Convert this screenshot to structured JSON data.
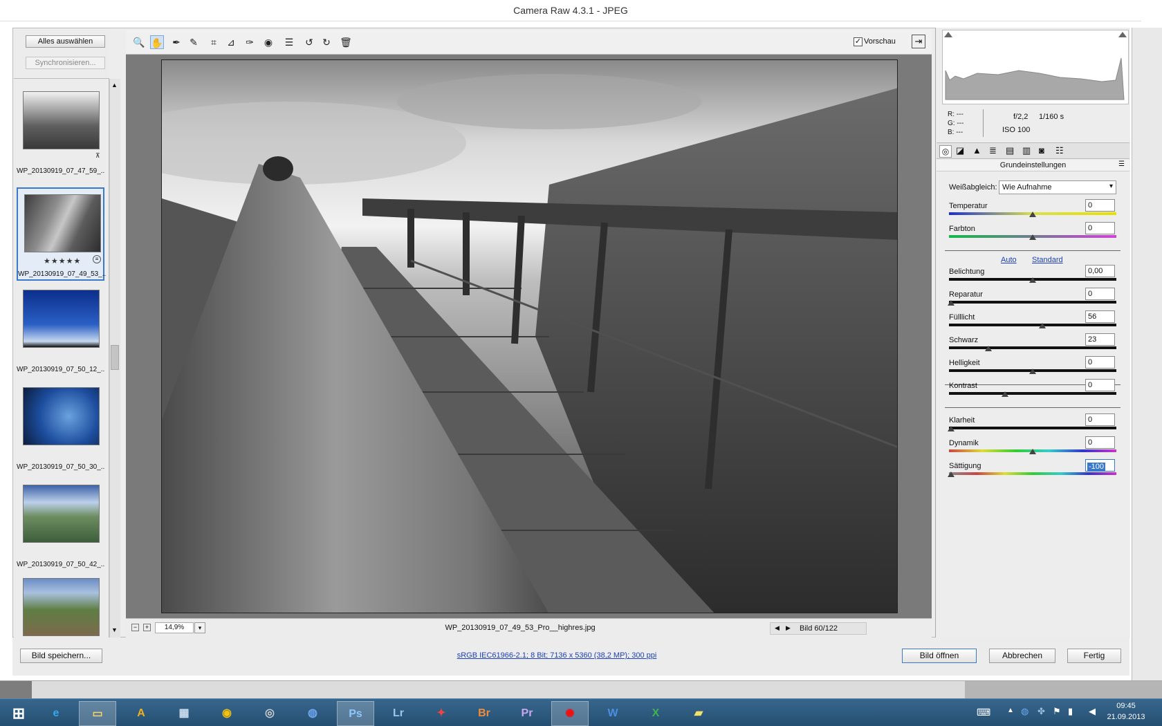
{
  "window": {
    "title": "Camera Raw 4.3.1 - JPEG"
  },
  "filmstrip": {
    "select_all": "Alles auswählen",
    "sync": "Synchronisieren...",
    "items": [
      {
        "name": "WP_20130919_07_47_59_...",
        "stars": ""
      },
      {
        "name": "WP_20130919_07_49_53_...",
        "stars": "★★★★★"
      },
      {
        "name": "WP_20130919_07_50_12_...",
        "stars": ""
      },
      {
        "name": "WP_20130919_07_50_30_...",
        "stars": ""
      },
      {
        "name": "WP_20130919_07_50_42_...",
        "stars": ""
      }
    ]
  },
  "toolbar": {
    "tools": [
      "zoom-icon",
      "hand-icon",
      "white-balance-icon",
      "color-sampler-icon",
      "crop-icon",
      "straighten-icon",
      "retouch-icon",
      "red-eye-icon",
      "preferences-icon",
      "rotate-left-icon",
      "rotate-right-icon",
      "trash-icon"
    ],
    "preview_label": "Vorschau"
  },
  "status": {
    "zoom": "14,9%",
    "filename": "WP_20130919_07_49_53_Pro__highres.jpg",
    "image_counter": "Bild 60/122"
  },
  "info": {
    "r": "R:  ---",
    "g": "G:  ---",
    "b": "B:  ---",
    "aperture": "f/2,2",
    "shutter": "1/160 s",
    "iso": "ISO 100"
  },
  "panel": {
    "title": "Grundeinstellungen",
    "wb_label": "Weißabgleich:",
    "wb_value": "Wie Aufnahme",
    "auto": "Auto",
    "standard": "Standard",
    "sliders": [
      {
        "label": "Temperatur",
        "value": "0",
        "pos": 0.5
      },
      {
        "label": "Farbton",
        "value": "0",
        "pos": 0.5
      },
      {
        "label": "Belichtung",
        "value": "0,00",
        "pos": 0.5
      },
      {
        "label": "Reparatur",
        "value": "0",
        "pos": 0.0
      },
      {
        "label": "Fülllicht",
        "value": "56",
        "pos": 0.56
      },
      {
        "label": "Schwarz",
        "value": "23",
        "pos": 0.23
      },
      {
        "label": "Helligkeit",
        "value": "0",
        "pos": 0.5
      },
      {
        "label": "Kontrast",
        "value": "0",
        "pos": 0.33
      },
      {
        "label": "Klarheit",
        "value": "0",
        "pos": 0.0
      },
      {
        "label": "Dynamik",
        "value": "0",
        "pos": 0.5
      },
      {
        "label": "Sättigung",
        "value": "-100",
        "pos": 0.0
      }
    ]
  },
  "bottom": {
    "save": "Bild speichern...",
    "workflow": "sRGB IEC61966-2.1; 8 Bit; 7136 x 5360 (38,2 MP); 300 ppi",
    "open": "Bild öffnen",
    "cancel": "Abbrechen",
    "done": "Fertig"
  },
  "taskbar": {
    "apps": [
      "Ps",
      "Lr",
      "Br",
      "Pr"
    ],
    "time": "09:45",
    "date": "21.09.2013"
  },
  "colors": {
    "accent": "#3a79c8",
    "taskbar": "#2d5a80"
  }
}
